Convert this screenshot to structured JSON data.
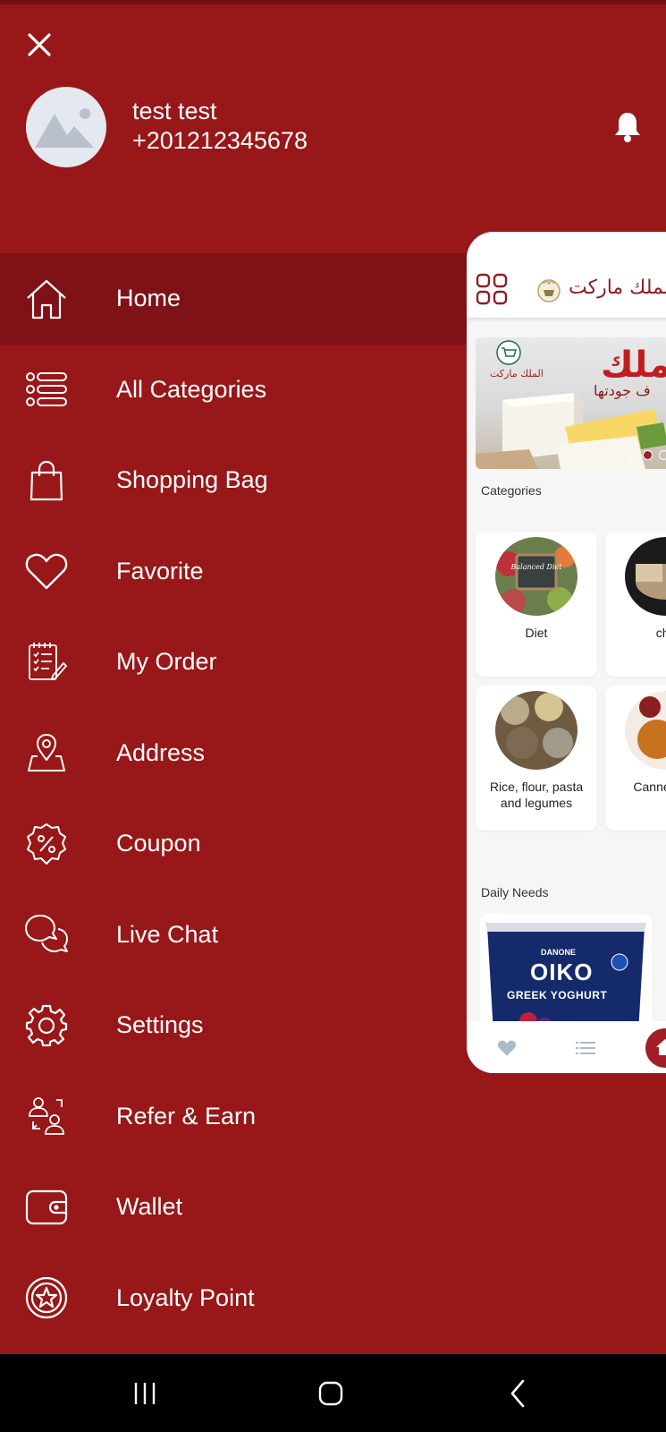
{
  "user": {
    "name": "test test",
    "phone": "+201212345678"
  },
  "menu": {
    "items": [
      {
        "label": "Home",
        "icon": "home-icon"
      },
      {
        "label": "All Categories",
        "icon": "list-icon"
      },
      {
        "label": "Shopping Bag",
        "icon": "shopping-bag-icon"
      },
      {
        "label": "Favorite",
        "icon": "heart-icon"
      },
      {
        "label": "My Order",
        "icon": "order-list-icon"
      },
      {
        "label": "Address",
        "icon": "map-pin-icon"
      },
      {
        "label": "Coupon",
        "icon": "coupon-icon"
      },
      {
        "label": "Live Chat",
        "icon": "chat-icon"
      },
      {
        "label": "Settings",
        "icon": "gear-icon"
      },
      {
        "label": "Refer & Earn",
        "icon": "refer-users-icon"
      },
      {
        "label": "Wallet",
        "icon": "wallet-icon"
      },
      {
        "label": "Loyalty Point",
        "icon": "star-badge-icon"
      }
    ],
    "active": "Home"
  },
  "preview": {
    "brand": "الملك ماركت",
    "banner": {
      "headline": "الملك",
      "tagline": "ف جودتها",
      "logo_text": "الملك ماركت"
    },
    "categories_title": "Categories",
    "categories": [
      {
        "label": "Diet",
        "sign": "Balanced Diet"
      },
      {
        "label": "che"
      },
      {
        "label": "Rice, flour, pasta and legumes"
      },
      {
        "label": "Canned hor"
      }
    ],
    "daily_needs_title": "Daily Needs",
    "product": {
      "brand": "DANONE",
      "name": "OIKO",
      "subtitle": "GREEK YOGHURT"
    }
  },
  "colors": {
    "primary": "#981719",
    "active": "#7e1216",
    "nav": "#000000"
  }
}
